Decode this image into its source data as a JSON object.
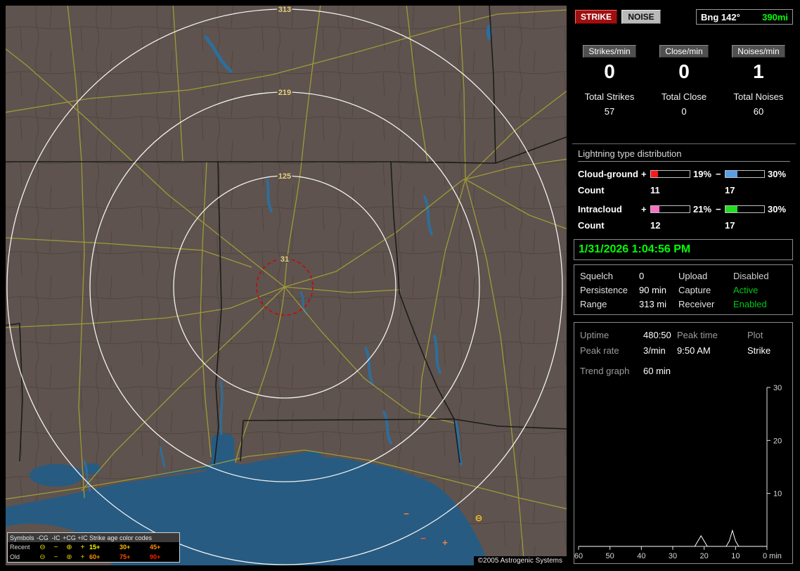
{
  "map": {
    "ring_labels": [
      "313",
      "219",
      "125",
      "31"
    ],
    "copyright": "©2005 Astrogenic Systems",
    "legend": {
      "symbols_title": "Symbols",
      "columns": [
        "-CG",
        "-IC",
        "+CG",
        "+IC"
      ],
      "age_title": "Strike age color codes",
      "rows": [
        {
          "label": "Recent",
          "symbols": [
            "⊖",
            "−",
            "⊕",
            "+"
          ],
          "ages": [
            {
              "text": "15+",
              "color": "#ffff00"
            },
            {
              "text": "30+",
              "color": "#ffc000"
            },
            {
              "text": "45+",
              "color": "#ff9000"
            }
          ]
        },
        {
          "label": "Old",
          "symbols": [
            "⊖",
            "−",
            "⊕",
            "+"
          ],
          "ages": [
            {
              "text": "60+",
              "color": "#ff9000"
            },
            {
              "text": "75+",
              "color": "#ff5000"
            },
            {
              "text": "90+",
              "color": "#ff2000"
            }
          ]
        }
      ]
    },
    "strike_markers": [
      {
        "glyph": "−",
        "x": 570,
        "y": 727,
        "color": "#ff8040"
      },
      {
        "glyph": "−",
        "x": 594,
        "y": 762,
        "color": "#e8602a"
      },
      {
        "glyph": "+",
        "x": 625,
        "y": 768,
        "color": "#ff8040"
      },
      {
        "glyph": "⊖",
        "x": 673,
        "y": 733,
        "color": "#ffc81e"
      }
    ]
  },
  "panel": {
    "strike_button": "STRIKE",
    "noise_button": "NOISE",
    "bearing": {
      "label": "Bng 142°",
      "value": "390mi",
      "value_color": "#00ff00"
    },
    "rate_counters": [
      {
        "label": "Strikes/min",
        "value": "0"
      },
      {
        "label": "Close/min",
        "value": "0"
      },
      {
        "label": "Noises/min",
        "value": "1"
      }
    ],
    "totals": [
      {
        "label": "Total Strikes",
        "value": "57"
      },
      {
        "label": "Total Close",
        "value": "0"
      },
      {
        "label": "Total Noises",
        "value": "60"
      }
    ],
    "signs": {
      "plus": "+",
      "minus": "−"
    },
    "distribution": {
      "title": "Lightning type distribution",
      "rows": [
        {
          "label": "Cloud-ground",
          "count_label": "Count",
          "plus_pct": "19%",
          "plus_color": "#ff1515",
          "plus_count": "11",
          "minus_pct": "30%",
          "minus_color": "#57a0e8",
          "minus_count": "17"
        },
        {
          "label": "Intracloud",
          "count_label": "Count",
          "plus_pct": "21%",
          "plus_color": "#ff6ec7",
          "plus_count": "12",
          "minus_pct": "30%",
          "minus_color": "#22dd22",
          "minus_count": "17"
        }
      ]
    },
    "datetime": "1/31/2026 1:04:56 PM",
    "status": {
      "rows": [
        {
          "label": "Squelch",
          "value": "0",
          "label2": "Upload",
          "value2": "Disabled",
          "value2_color": "#cccccc"
        },
        {
          "label": "Persistence",
          "value": "90 min",
          "label2": "Capture",
          "value2": "Active",
          "value2_color": "#00c814"
        },
        {
          "label": "Range",
          "value": "313 mi",
          "label2": "Receiver",
          "value2": "Enabled",
          "value2_color": "#00c814"
        }
      ]
    },
    "stats": {
      "uptime_label": "Uptime",
      "uptime_value": "480:50",
      "peak_time_label": "Peak time",
      "peak_time_value": "9:50 AM",
      "plot_label": "Plot",
      "plot_value": "Strike",
      "peak_rate_label": "Peak rate",
      "peak_rate_value": "3/min",
      "trend_label": "Trend graph",
      "trend_value": "60 min"
    }
  },
  "chart_data": {
    "type": "line",
    "title": "Trend graph - strikes per minute, last 60 minutes",
    "xlabel": "min",
    "ylabel": "",
    "x_tick_labels": [
      "60",
      "50",
      "40",
      "30",
      "20",
      "10",
      "0 min"
    ],
    "y_ticks": [
      30,
      20,
      10
    ],
    "ylim": [
      0,
      30
    ],
    "xlim_minutes_ago": [
      60,
      0
    ],
    "series": [
      {
        "name": "Strike",
        "values_per_minute_ago_60_to_0": [
          0,
          0,
          0,
          0,
          0,
          0,
          0,
          0,
          0,
          0,
          0,
          0,
          0,
          0,
          0,
          0,
          0,
          0,
          0,
          0,
          0,
          0,
          0,
          0,
          0,
          0,
          0,
          0,
          0,
          0,
          0,
          0,
          0,
          0,
          0,
          0,
          0,
          0,
          1,
          2,
          1,
          0,
          0,
          0,
          0,
          0,
          0,
          0,
          1,
          3,
          1,
          0,
          0,
          0,
          0,
          0,
          0,
          0,
          0,
          0,
          0
        ]
      }
    ]
  }
}
